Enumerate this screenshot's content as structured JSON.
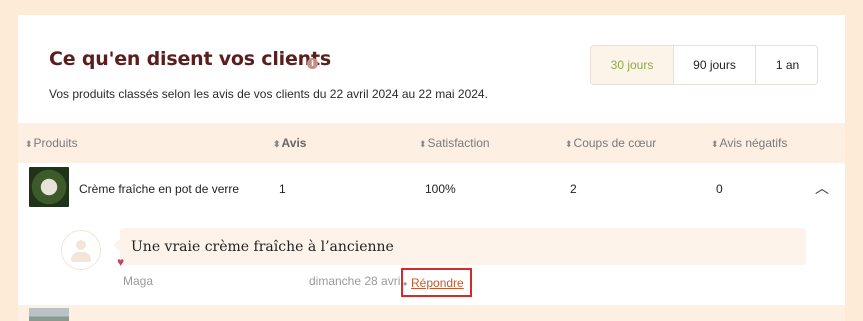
{
  "section": {
    "title": "Ce qu'en disent vos clients",
    "info_icon": "i",
    "subtitle": "Vos produits classés selon les avis de vos clients du 22 avril 2024 au 22 mai 2024."
  },
  "periods": [
    {
      "label": "30 jours",
      "active": true
    },
    {
      "label": "90 jours",
      "active": false
    },
    {
      "label": "1 an",
      "active": false
    }
  ],
  "table": {
    "sort_icon": "sort-arrows-icon",
    "columns": [
      "Produits",
      "Avis",
      "Satisfaction",
      "Coups de cœur",
      "Avis négatifs"
    ],
    "rows": [
      {
        "product": "Crème fraîche en pot de verre",
        "avis": "1",
        "satisfaction": "100%",
        "coups_de_coeur": "2",
        "avis_negatifs": "0",
        "expanded": true
      }
    ]
  },
  "review": {
    "text": "Une vraie crème fraîche à l’ancienne",
    "author": "Maga",
    "date": "dimanche 28 avril",
    "separator": "•",
    "reply_label": "Répondre",
    "heart_icon": "heart-icon",
    "highlight_color": "#d42a2a"
  },
  "colors": {
    "accent_green": "#8ea94a",
    "title": "#5a1e1e",
    "page_bg": "#fdebd6"
  }
}
